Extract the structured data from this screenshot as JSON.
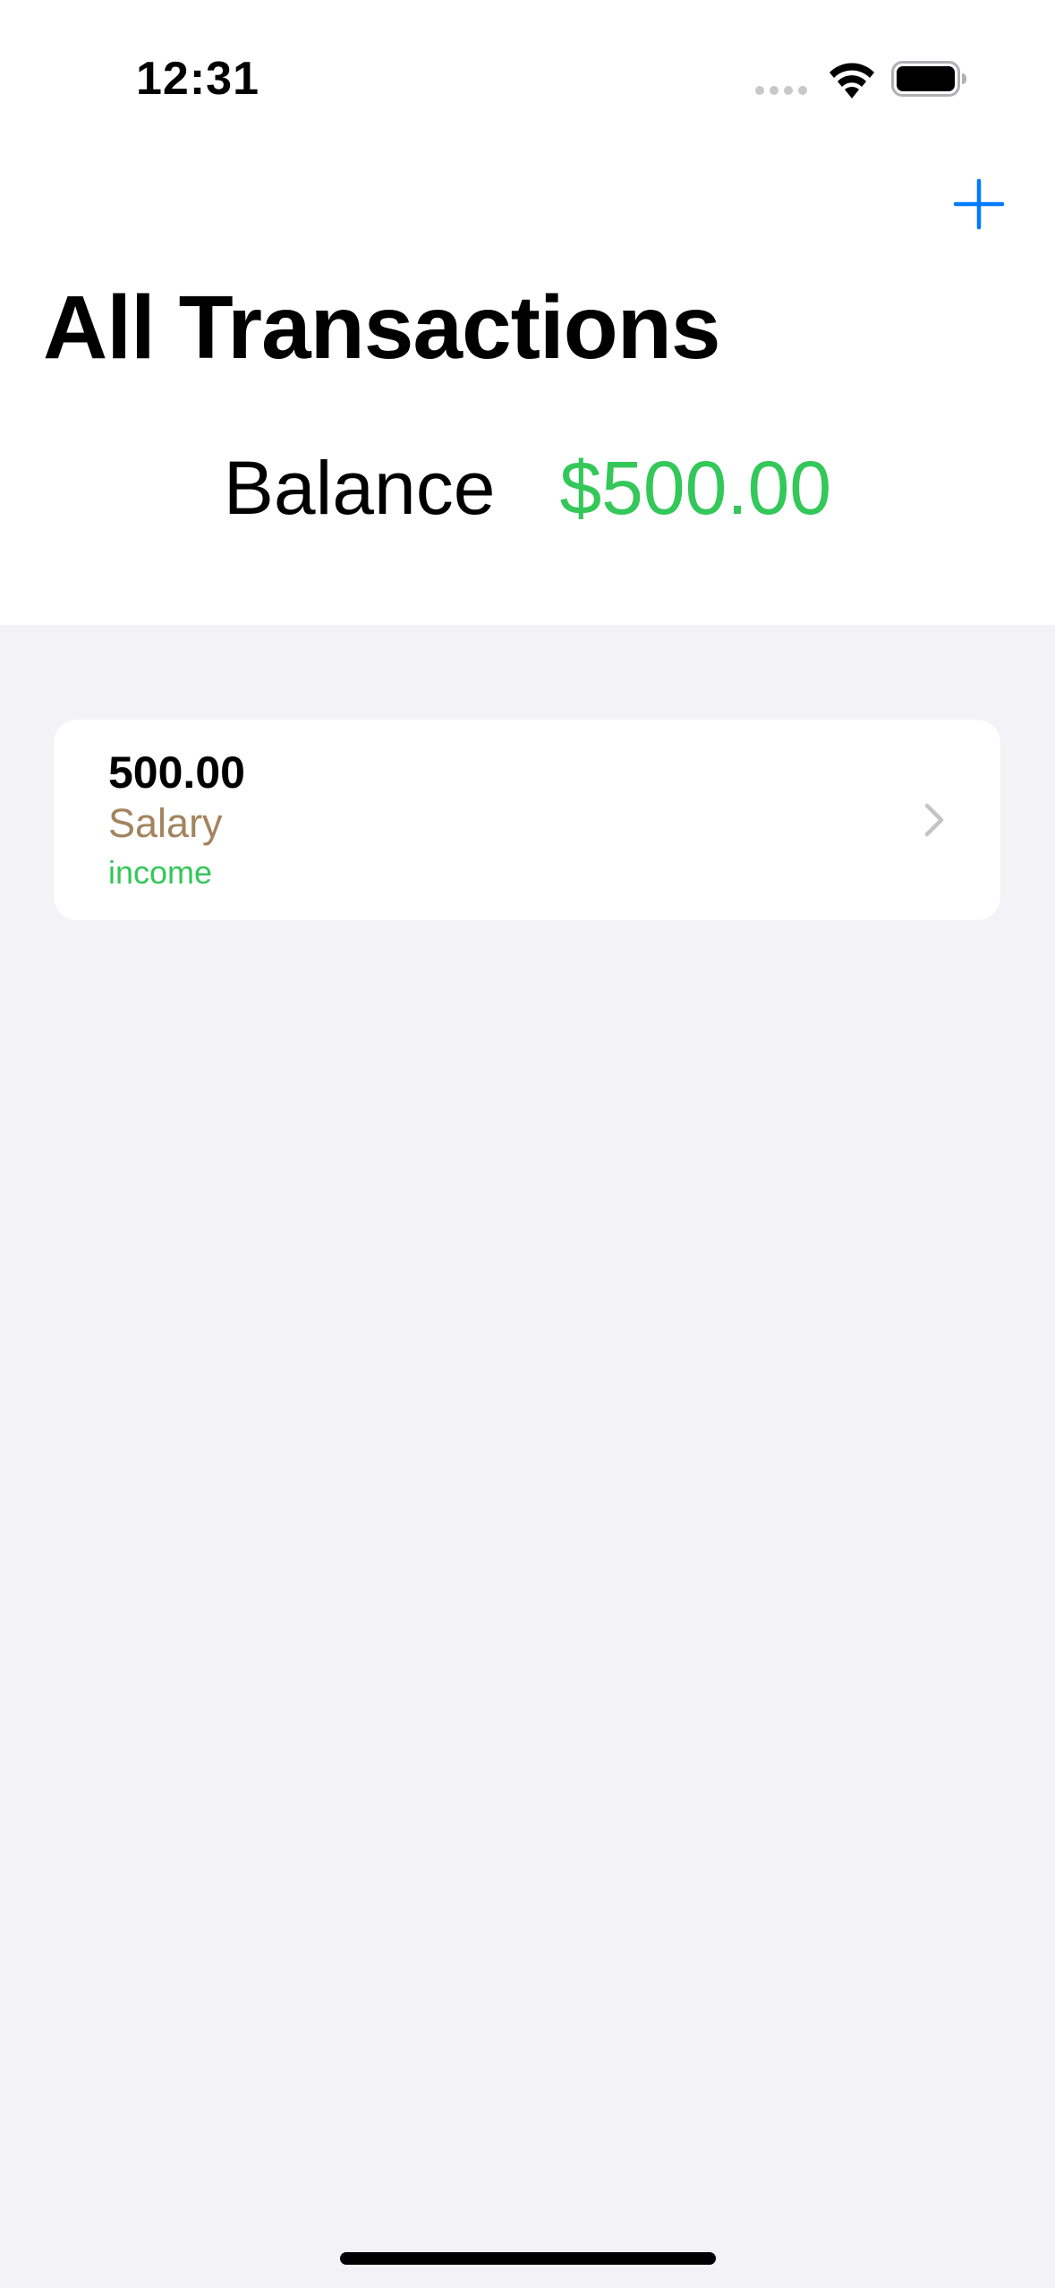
{
  "status_bar": {
    "time": "12:31",
    "icons": [
      "cellular-signal-icon",
      "wifi-icon",
      "battery-icon"
    ]
  },
  "nav": {
    "add_icon": "plus-icon",
    "title": "All Transactions"
  },
  "balance": {
    "label": "Balance",
    "amount": "$500.00"
  },
  "transactions": [
    {
      "amount": "500.00",
      "name": "Salary",
      "type": "income"
    }
  ],
  "colors": {
    "accent": "#007aff",
    "income": "#34c759",
    "category": "#a2845e",
    "grouped_background": "#f2f2f7"
  }
}
